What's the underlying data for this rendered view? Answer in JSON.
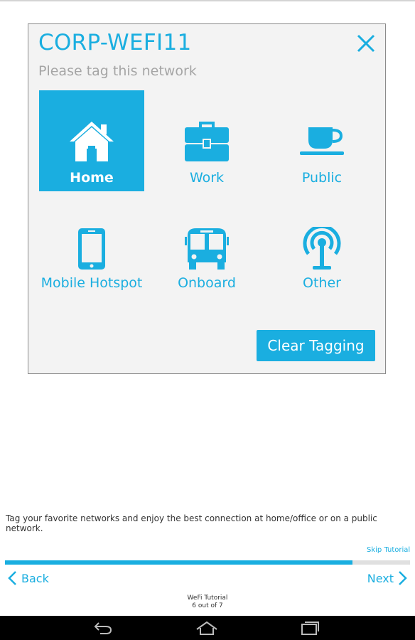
{
  "dialog": {
    "network_name": "CORP-WEFI11",
    "subtitle": "Please tag this network",
    "tags": [
      {
        "label": "Home",
        "icon": "home-icon",
        "selected": true
      },
      {
        "label": "Work",
        "icon": "briefcase-icon",
        "selected": false
      },
      {
        "label": "Public",
        "icon": "coffee-cup-icon",
        "selected": false
      },
      {
        "label": "Mobile Hotspot",
        "icon": "mobile-phone-icon",
        "selected": false
      },
      {
        "label": "Onboard",
        "icon": "bus-icon",
        "selected": false
      },
      {
        "label": "Other",
        "icon": "antenna-icon",
        "selected": false
      }
    ],
    "clear_label": "Clear Tagging"
  },
  "caption": "Tag your favorite networks and enjoy the best connection at home/office or on a public network.",
  "skip_label": "Skip Tutorial",
  "progress": {
    "current": 6,
    "total": 7
  },
  "nav": {
    "back_label": "Back",
    "next_label": "Next"
  },
  "footer": {
    "title": "WeFi Tutorial",
    "page": "6 out of 7"
  },
  "colors": {
    "accent": "#1aaee0",
    "navbar": "#000000"
  }
}
